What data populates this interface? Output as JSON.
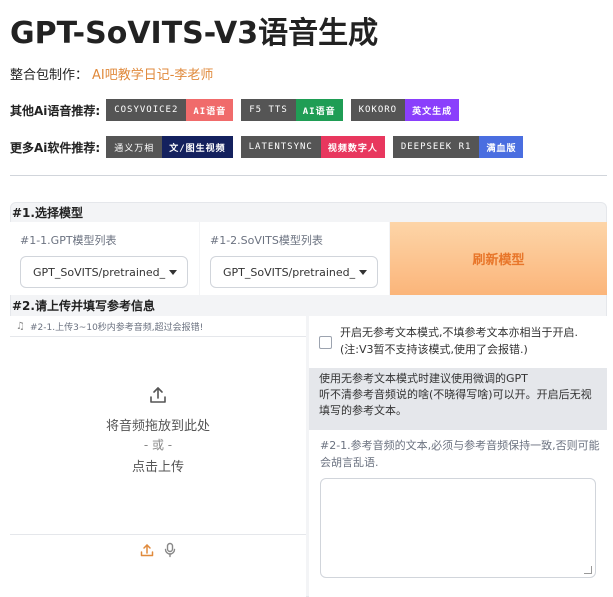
{
  "header": {
    "title": "GPT-SoVITS-V3语音生成",
    "author_label": "整合包制作：",
    "author_value": "AI吧教学日记-李老师"
  },
  "badges_voice": {
    "label": "其他Ai语音推荐:",
    "items": [
      {
        "left": "COSYVOICE2",
        "right": "AI语音",
        "color": "#f06b6b"
      },
      {
        "left": "F5 TTS",
        "right": "AI语音",
        "color": "#1f9d55"
      },
      {
        "left": "KOKORO",
        "right": "英文生成",
        "color": "#8a3ffc"
      }
    ]
  },
  "badges_software": {
    "label": "更多Ai软件推荐:",
    "items": [
      {
        "left": "通义万相",
        "right": "文/图生视频",
        "color": "#14215e"
      },
      {
        "left": "LATENTSYNC",
        "right": "视频数字人",
        "color": "#e8375e"
      },
      {
        "left": "DEEPSEEK R1",
        "right": "满血版",
        "color": "#4a6ee0"
      }
    ]
  },
  "section1": {
    "label": "#1.选择模型",
    "gpt_label": "#1-1.GPT模型列表",
    "gpt_value": "GPT_SoVITS/pretrained_",
    "sovits_label": "#1-2.SoVITS模型列表",
    "sovits_value": "GPT_SoVITS/pretrained_",
    "refresh_label": "刷新模型"
  },
  "section2": {
    "label": "#2.请上传并填写参考信息",
    "upload_hint": "#2-1.上传3~10秒内参考音频,超过会报错!",
    "drop_text": "将音频拖放到此处",
    "or_text": "- 或 -",
    "click_text": "点击上传",
    "checkbox_text": "开启无参考文本模式,不填参考文本亦相当于开启.(注:V3暂不支持该模式,使用了会报错.)",
    "info_text": "使用无参考文本模式时建议使用微调的GPT\n听不清参考音频说的啥(不晓得写啥)可以开。开启后无视填写的参考文本。",
    "ref_label": "#2-1.参考音频的文本,必须与参考音频保持一致,否则可能会胡言乱语.",
    "ref_value": ""
  }
}
